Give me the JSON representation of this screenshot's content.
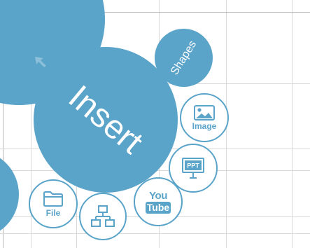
{
  "menu": {
    "center_label": "Insert",
    "shapes_label": "Shapes",
    "items": [
      {
        "label": "Image",
        "icon": "image-icon"
      },
      {
        "label": "",
        "icon": "ppt-icon",
        "icon_text": "PPT"
      },
      {
        "label": "",
        "icon": "youtube-icon",
        "icon_text_top": "You",
        "icon_text_bottom": "Tube"
      },
      {
        "label": "",
        "icon": "network-diagram-icon"
      },
      {
        "label": "File",
        "icon": "folder-icon"
      }
    ]
  },
  "colors": {
    "accent": "#5aa3c9",
    "background": "#ffffff",
    "grid": "#d9d9d9"
  }
}
